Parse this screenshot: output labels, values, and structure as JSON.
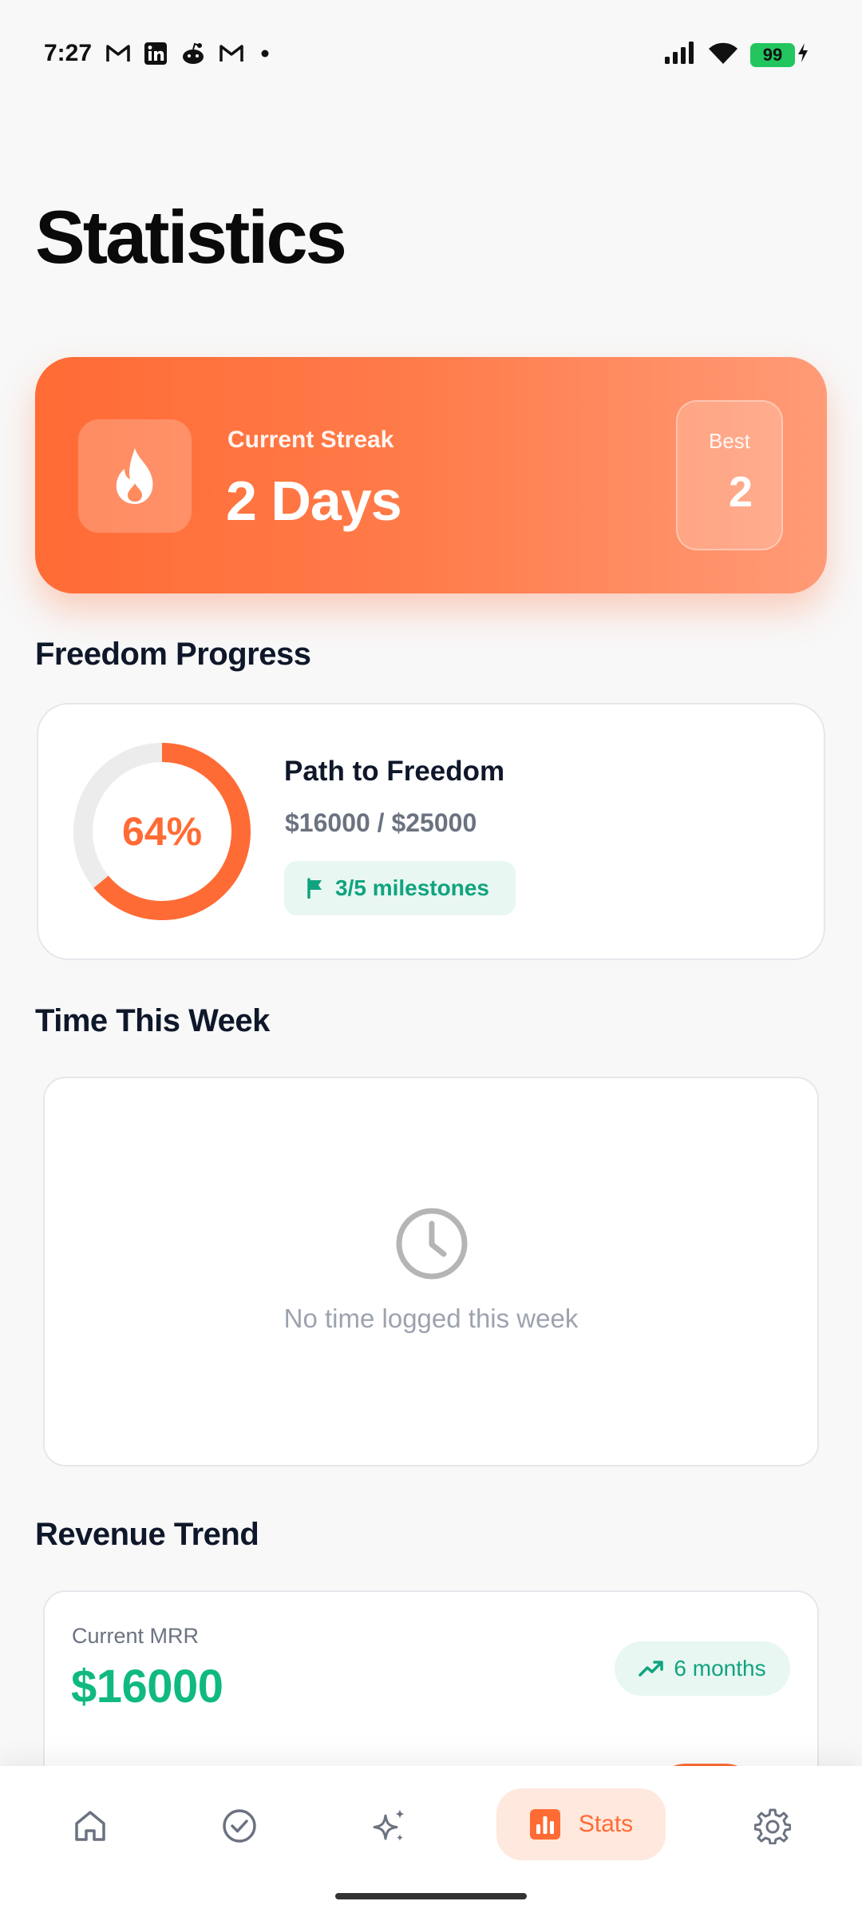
{
  "status_bar": {
    "time": "7:27",
    "battery": "99"
  },
  "page": {
    "title": "Statistics"
  },
  "streak": {
    "label": "Current Streak",
    "value": "2 Days",
    "best_label": "Best",
    "best_value": "2"
  },
  "freedom": {
    "section_title": "Freedom Progress",
    "percent_text": "64%",
    "progress": 0.64,
    "title": "Path to Freedom",
    "amounts": "$16000 / $25000",
    "milestones": "3/5 milestones"
  },
  "time_week": {
    "section_title": "Time This Week",
    "empty_text": "No time logged this week"
  },
  "revenue": {
    "section_title": "Revenue Trend",
    "mrr_label": "Current MRR",
    "mrr_value": "$16000",
    "months": "6 months"
  },
  "nav": {
    "stats_label": "Stats"
  },
  "colors": {
    "accent": "#ff6b35",
    "green": "#10b981",
    "green_bg": "#e8f7f1"
  }
}
